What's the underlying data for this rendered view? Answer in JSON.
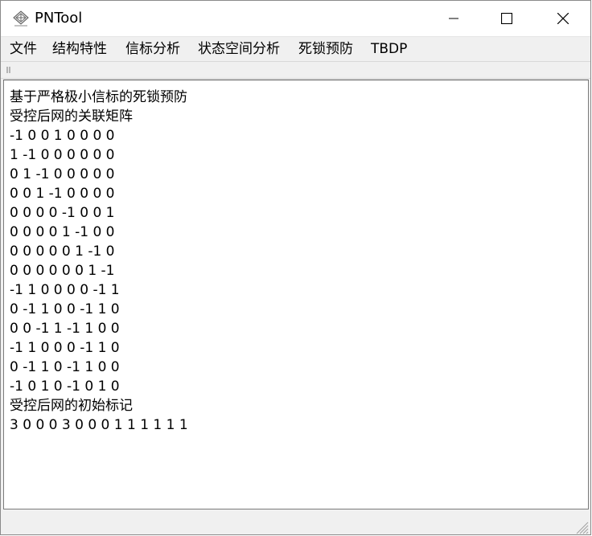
{
  "window": {
    "title": "PNTool",
    "icon": "pntool-app-icon",
    "controls": [
      "minimize-icon",
      "maximize-icon",
      "close-icon"
    ]
  },
  "menu": {
    "items": [
      "文件",
      "结构特性",
      "信标分析",
      "状态空间分析",
      "死锁预防",
      "TBDP"
    ]
  },
  "toolbar": {
    "grip": "toolbar-grip-icon"
  },
  "content": {
    "text": "基于严格极小信标的死锁预防\n受控后网的关联矩阵\n-1 0 0 1 0 0 0 0\n1 -1 0 0 0 0 0 0\n0 1 -1 0 0 0 0 0\n0 0 1 -1 0 0 0 0\n0 0 0 0 -1 0 0 1\n0 0 0 0 1 -1 0 0\n0 0 0 0 0 1 -1 0\n0 0 0 0 0 0 1 -1\n-1 1 0 0 0 0 -1 1\n0 -1 1 0 0 -1 1 0\n0 0 -1 1 -1 1 0 0\n-1 1 0 0 0 -1 1 0\n0 -1 1 0 -1 1 0 0\n-1 0 1 0 -1 0 1 0\n受控后网的初始标记\n3 0 0 0 3 0 0 0 1 1 1 1 1 1"
  },
  "statusbar": {
    "resize_grip": "resize-grip-icon"
  }
}
